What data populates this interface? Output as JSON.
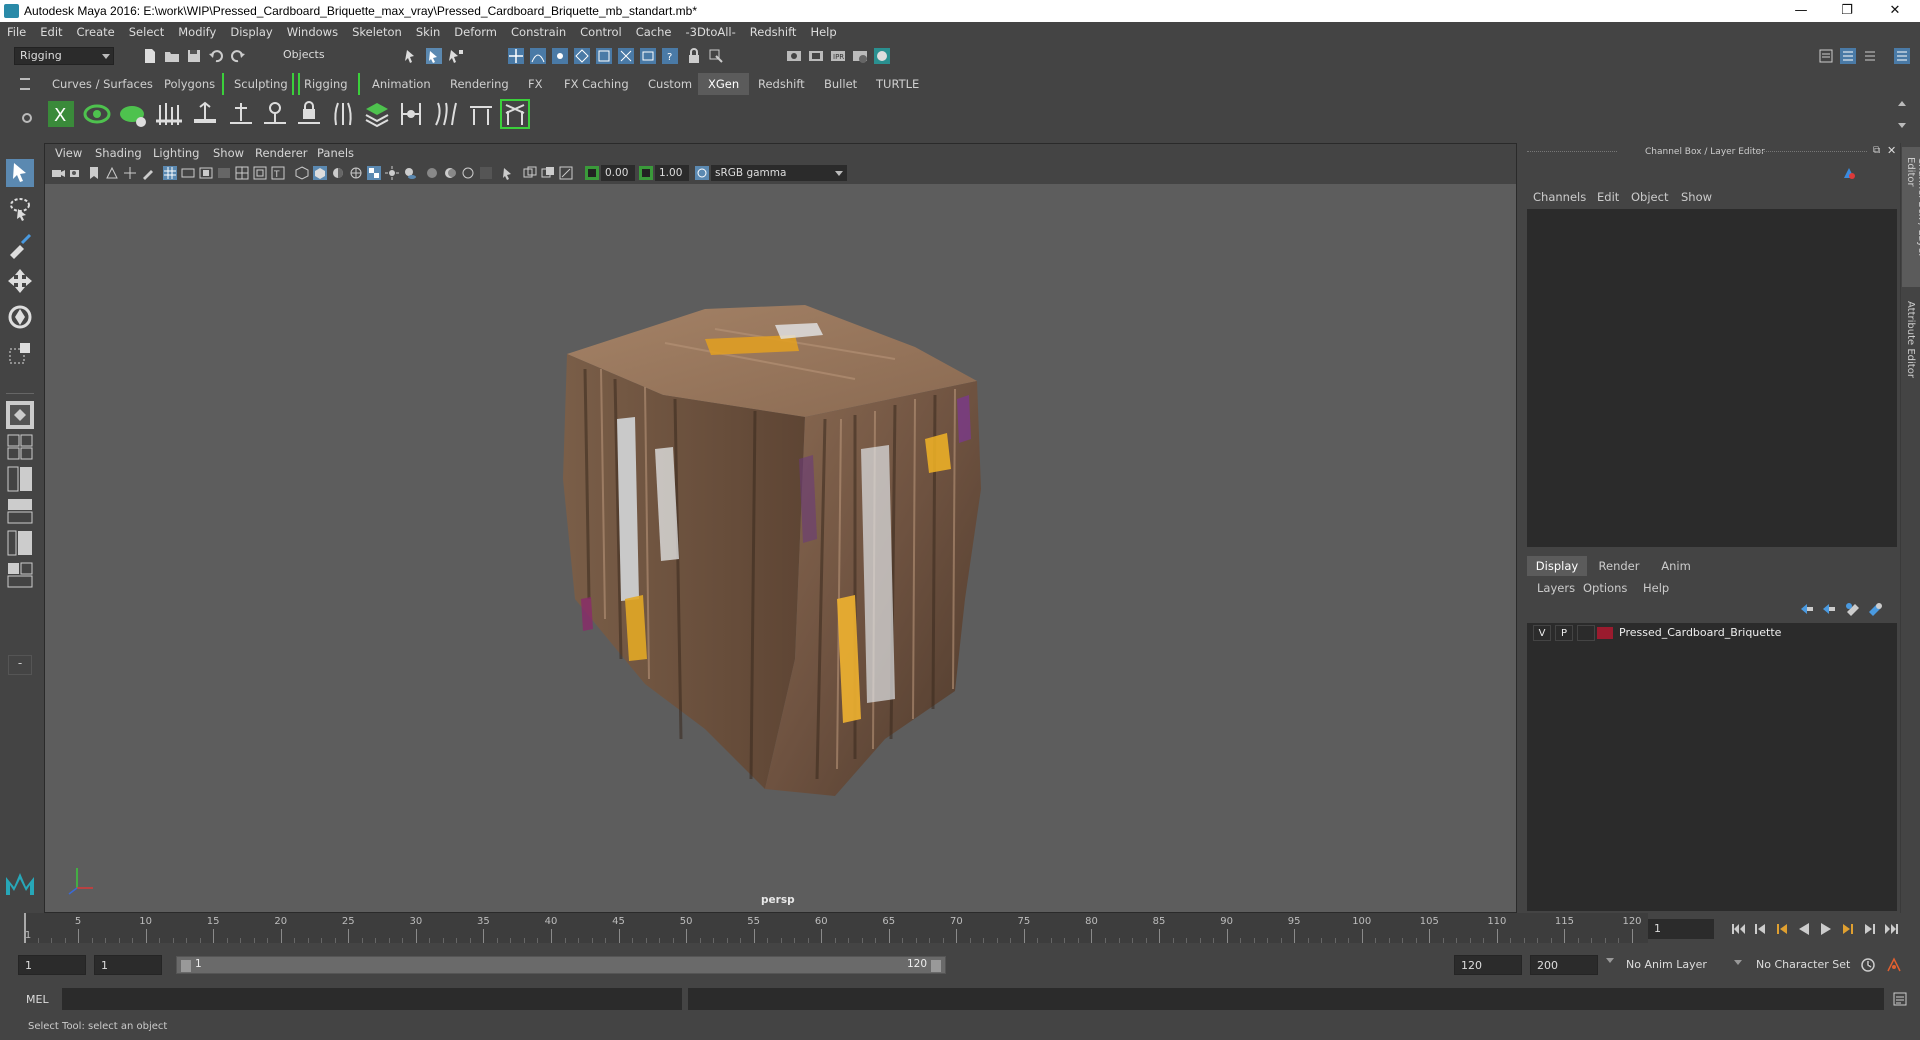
{
  "window": {
    "title": "Autodesk Maya 2016: E:\\work\\WIP\\Pressed_Cardboard_Briquette_max_vray\\Pressed_Cardboard_Briquette_mb_standart.mb*",
    "minimize": "—",
    "restore": "❐",
    "close": "✕"
  },
  "menubar": [
    "File",
    "Edit",
    "Create",
    "Select",
    "Modify",
    "Display",
    "Windows",
    "Skeleton",
    "Skin",
    "Deform",
    "Constrain",
    "Control",
    "Cache",
    "-3DtoAll-",
    "Redshift",
    "Help"
  ],
  "statusline": {
    "mode": "Rigging",
    "selection_mode": "Objects"
  },
  "shelf_tabs": [
    "Curves / Surfaces",
    "Polygons",
    "Sculpting",
    "Rigging",
    "Animation",
    "Rendering",
    "FX",
    "FX Caching",
    "Custom",
    "XGen",
    "Redshift",
    "Bullet",
    "TURTLE"
  ],
  "shelf_active_tab": "XGen",
  "viewport": {
    "menu": [
      "View",
      "Shading",
      "Lighting",
      "Show",
      "Renderer",
      "Panels"
    ],
    "exposure": "0.00",
    "gamma": "1.00",
    "color_space": "sRGB gamma",
    "camera_label": "persp"
  },
  "channel_box": {
    "title": "Channel Box / Layer Editor",
    "menu": [
      "Channels",
      "Edit",
      "Object",
      "Show"
    ]
  },
  "layer_editor": {
    "tabs": [
      "Display",
      "Render",
      "Anim"
    ],
    "active_tab": "Display",
    "menu": [
      "Layers",
      "Options",
      "Help"
    ],
    "layers": [
      {
        "visible": "V",
        "playback": "P",
        "name": "Pressed_Cardboard_Briquette",
        "color": "#9a1b2e"
      }
    ]
  },
  "side_tabs": [
    "Channel Box / Layer Editor",
    "Attribute Editor"
  ],
  "timeline": {
    "ticks": [
      1,
      5,
      10,
      15,
      20,
      25,
      30,
      35,
      40,
      45,
      50,
      55,
      60,
      65,
      70,
      75,
      80,
      85,
      90,
      95,
      100,
      105,
      110,
      115,
      120
    ],
    "current_frame": "1"
  },
  "range": {
    "start": "1",
    "playback_start": "1",
    "slider_start": "1",
    "slider_end": "120",
    "playback_end": "120",
    "end": "200",
    "anim_layer": "No Anim Layer",
    "character_set": "No Character Set"
  },
  "command_line": {
    "label": "MEL",
    "help_text": "Select Tool: select an object"
  }
}
